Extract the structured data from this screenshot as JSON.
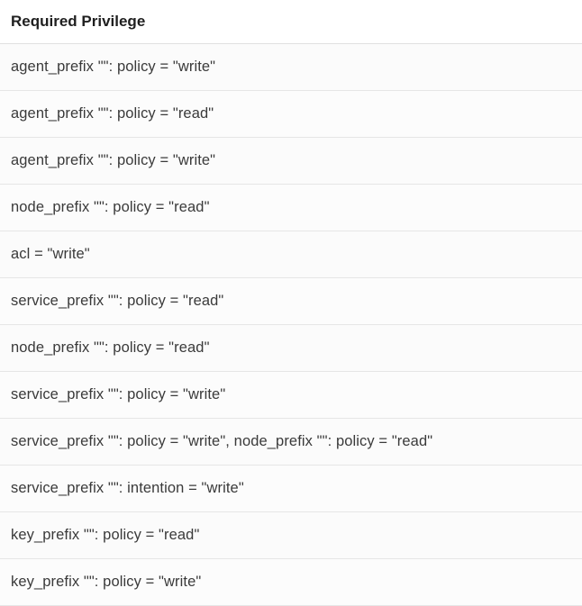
{
  "header": "Required Privilege",
  "rows": [
    "agent_prefix \"\": policy = \"write\"",
    "agent_prefix \"\": policy = \"read\"",
    "agent_prefix \"\": policy = \"write\"",
    "node_prefix \"\": policy = \"read\"",
    "acl = \"write\"",
    "service_prefix \"\": policy = \"read\"",
    "node_prefix \"\": policy = \"read\"",
    "service_prefix \"\": policy = \"write\"",
    "service_prefix \"\": policy = \"write\", node_prefix \"\": policy = \"read\"",
    "service_prefix \"\": intention = \"write\"",
    "key_prefix \"\": policy = \"read\"",
    "key_prefix \"\": policy = \"write\""
  ]
}
